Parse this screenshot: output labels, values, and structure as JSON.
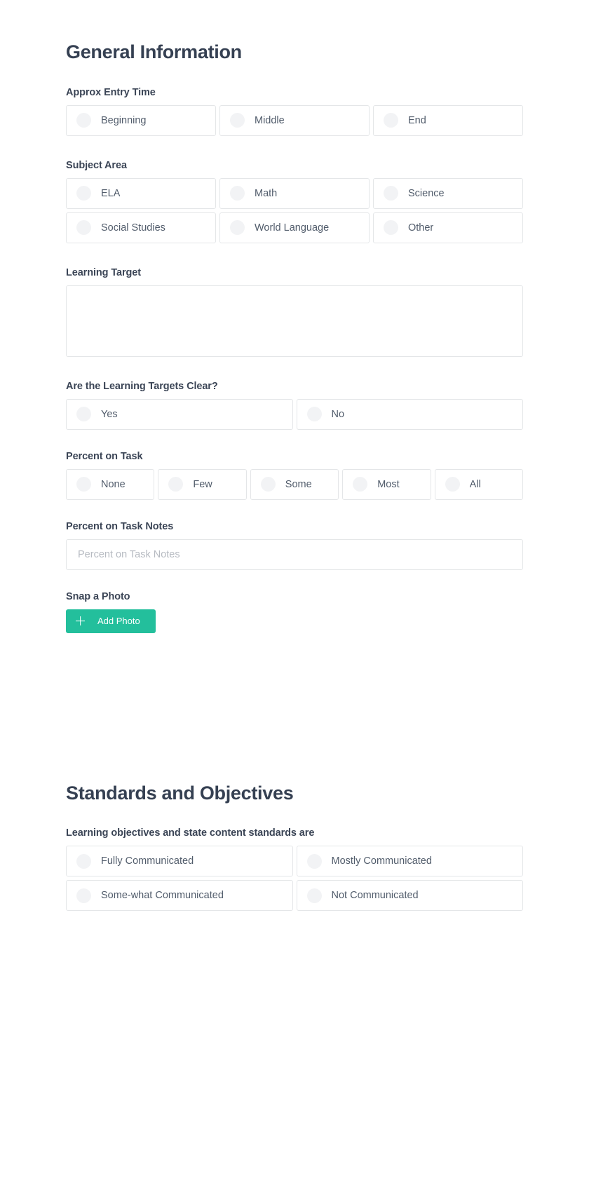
{
  "sections": [
    {
      "id": "general",
      "title": "General Information",
      "fields": [
        {
          "label": "Approx Entry Time",
          "type": "radio-grid",
          "columns": 3,
          "options": [
            "Beginning",
            "Middle",
            "End"
          ]
        },
        {
          "label": "Subject Area",
          "type": "radio-grid",
          "columns": 3,
          "options": [
            "ELA",
            "Math",
            "Science",
            "Social Studies",
            "World Language",
            "Other"
          ]
        },
        {
          "label": "Learning Target",
          "type": "textarea",
          "value": ""
        },
        {
          "label": "Are the Learning Targets Clear?",
          "type": "radio-grid",
          "columns": 2,
          "options": [
            "Yes",
            "No"
          ]
        },
        {
          "label": "Percent on Task",
          "type": "radio-grid",
          "columns": 5,
          "options": [
            "None",
            "Few",
            "Some",
            "Most",
            "All"
          ]
        },
        {
          "label": "Percent on Task Notes",
          "type": "text",
          "value": "",
          "placeholder": "Percent on Task Notes"
        },
        {
          "label": "Snap a Photo",
          "type": "button",
          "button_label": "Add Photo",
          "icon": "plus-icon"
        }
      ]
    },
    {
      "id": "standards",
      "title": "Standards and Objectives",
      "fields": [
        {
          "label": "Learning objectives and state content standards are",
          "type": "radio-grid",
          "columns": 2,
          "options": [
            "Fully Communicated",
            "Mostly Communicated",
            "Some-what Communicated",
            "Not Communicated"
          ]
        }
      ]
    }
  ],
  "colors": {
    "accent": "#23bf9c",
    "heading": "#354052",
    "label": "#3b4556",
    "option_text": "#515c6b",
    "border": "#e4e6e8",
    "radio_fill": "#f2f3f5",
    "placeholder": "#b6bac1"
  }
}
